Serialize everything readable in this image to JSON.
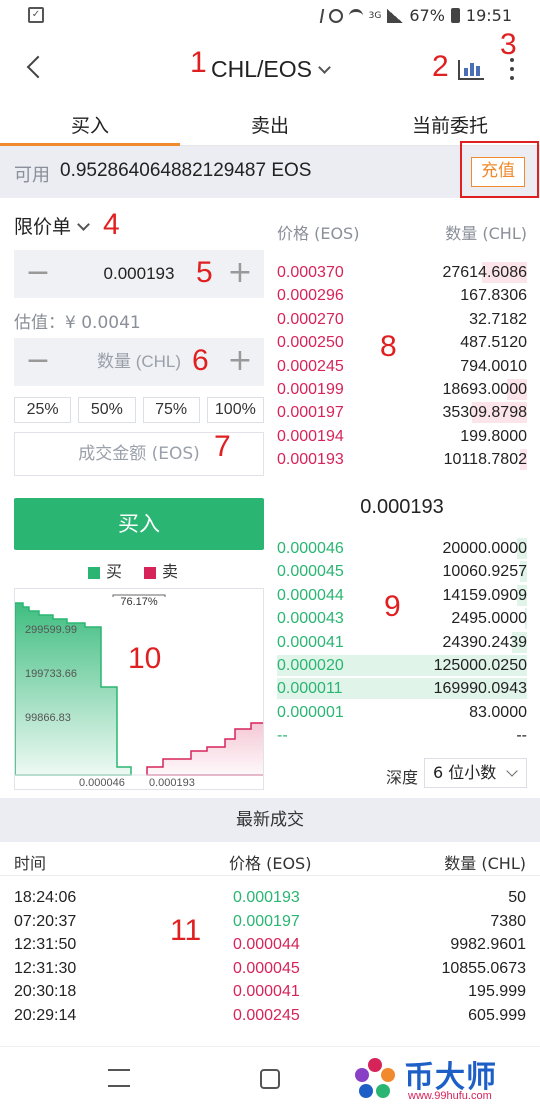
{
  "status_bar": {
    "battery": "67%",
    "time": "19:51",
    "signal_label": "3G"
  },
  "header": {
    "pair": "CHL/EOS"
  },
  "tabs": [
    "买入",
    "卖出",
    "当前委托"
  ],
  "balance": {
    "label": "可用",
    "value": "0.952864064882129487 EOS",
    "recharge": "充值"
  },
  "order_form": {
    "order_type": "限价单",
    "price_value": "0.000193",
    "estimate": "估值：¥ 0.0041",
    "amount_placeholder": "数量 (CHL)",
    "percentages": [
      "25%",
      "50%",
      "75%",
      "100%"
    ],
    "total_placeholder": "成交金额 (EOS)",
    "buy_label": "买入"
  },
  "legend": {
    "buy": "买",
    "sell": "卖"
  },
  "depth_chart": {
    "pct_label": "76.17%",
    "y_labels": [
      "299599.99",
      "199733.66",
      "99866.83"
    ],
    "x_labels": [
      "0.000046",
      "0.000193"
    ],
    "colors": {
      "buy": "#2ab672",
      "sell": "#d6245a"
    }
  },
  "orderbook": {
    "price_header": "价格 (EOS)",
    "qty_header": "数量 (CHL)",
    "asks": [
      {
        "price": "0.000370",
        "qty": "27614.6086",
        "depth": 0.18
      },
      {
        "price": "0.000296",
        "qty": "167.8306",
        "depth": 0.0
      },
      {
        "price": "0.000270",
        "qty": "32.7182",
        "depth": 0.0
      },
      {
        "price": "0.000250",
        "qty": "487.5120",
        "depth": 0.0
      },
      {
        "price": "0.000245",
        "qty": "794.0010",
        "depth": 0.0
      },
      {
        "price": "0.000199",
        "qty": "18693.0000",
        "depth": 0.08
      },
      {
        "price": "0.000197",
        "qty": "35309.8798",
        "depth": 0.22
      },
      {
        "price": "0.000194",
        "qty": "199.8000",
        "depth": 0.0
      },
      {
        "price": "0.000193",
        "qty": "10118.7802",
        "depth": 0.03
      }
    ],
    "last_price": "0.000193",
    "bids": [
      {
        "price": "0.000046",
        "qty": "20000.0000",
        "depth": 0.04
      },
      {
        "price": "0.000045",
        "qty": "10060.9257",
        "depth": 0.03
      },
      {
        "price": "0.000044",
        "qty": "14159.0909",
        "depth": 0.04
      },
      {
        "price": "0.000043",
        "qty": "2495.0000",
        "depth": 0.01
      },
      {
        "price": "0.000041",
        "qty": "24390.2439",
        "depth": 0.06
      },
      {
        "price": "0.000020",
        "qty": "125000.0250",
        "depth": 1.0
      },
      {
        "price": "0.000011",
        "qty": "169990.0943",
        "depth": 1.0
      },
      {
        "price": "0.000001",
        "qty": "83.0000",
        "depth": 0.0
      },
      {
        "price": "--",
        "qty": "--",
        "depth": 0.0
      }
    ],
    "depth_label": "深度",
    "depth_value": "6 位小数"
  },
  "trades": {
    "title": "最新成交",
    "col_time": "时间",
    "col_price": "价格 (EOS)",
    "col_qty": "数量 (CHL)",
    "rows": [
      {
        "time": "18:24:06",
        "price": "0.000193",
        "qty": "50",
        "side": "buy"
      },
      {
        "time": "07:20:37",
        "price": "0.000197",
        "qty": "7380",
        "side": "buy"
      },
      {
        "time": "12:31:50",
        "price": "0.000044",
        "qty": "9982.9601",
        "side": "sell"
      },
      {
        "time": "12:31:30",
        "price": "0.000045",
        "qty": "10855.0673",
        "side": "sell"
      },
      {
        "time": "20:30:18",
        "price": "0.000041",
        "qty": "195.999",
        "side": "sell"
      },
      {
        "time": "20:29:14",
        "price": "0.000245",
        "qty": "605.999",
        "side": "sell"
      }
    ]
  },
  "annotations": [
    "1",
    "2",
    "3",
    "4",
    "5",
    "6",
    "7",
    "8",
    "9",
    "10",
    "11"
  ],
  "watermark": {
    "text": "币大师",
    "url": "www.99hufu.com"
  }
}
